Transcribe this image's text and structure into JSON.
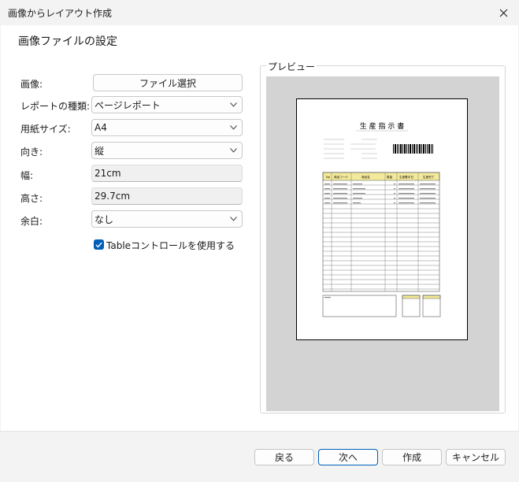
{
  "window": {
    "title": "画像からレイアウト作成",
    "close_icon": "close-icon"
  },
  "heading": "画像ファイルの設定",
  "form": {
    "image_label": "画像:",
    "file_button": "ファイル選択",
    "report_type_label": "レポートの種類:",
    "report_type_value": "ページレポート",
    "paper_size_label": "用紙サイズ:",
    "paper_size_value": "A4",
    "orientation_label": "向き:",
    "orientation_value": "縦",
    "width_label": "幅:",
    "width_value": "21cm",
    "height_label": "高さ:",
    "height_value": "29.7cm",
    "margin_label": "余白:",
    "margin_value": "なし",
    "table_control_checked": true,
    "table_control_label": "Tableコントロールを使用する"
  },
  "preview": {
    "group_label": "プレビュー",
    "doc_title": "生 産 指 示 書",
    "table_headers": [
      "No",
      "商品コード",
      "商品名",
      "数量",
      "生産着手日",
      "生産完了"
    ]
  },
  "footer": {
    "back": "戻る",
    "next": "次へ",
    "create": "作成",
    "cancel": "キャンセル"
  },
  "colors": {
    "accent": "#005fb8",
    "table_header": "#f3e99a",
    "preview_bg": "#d3d3d3"
  }
}
